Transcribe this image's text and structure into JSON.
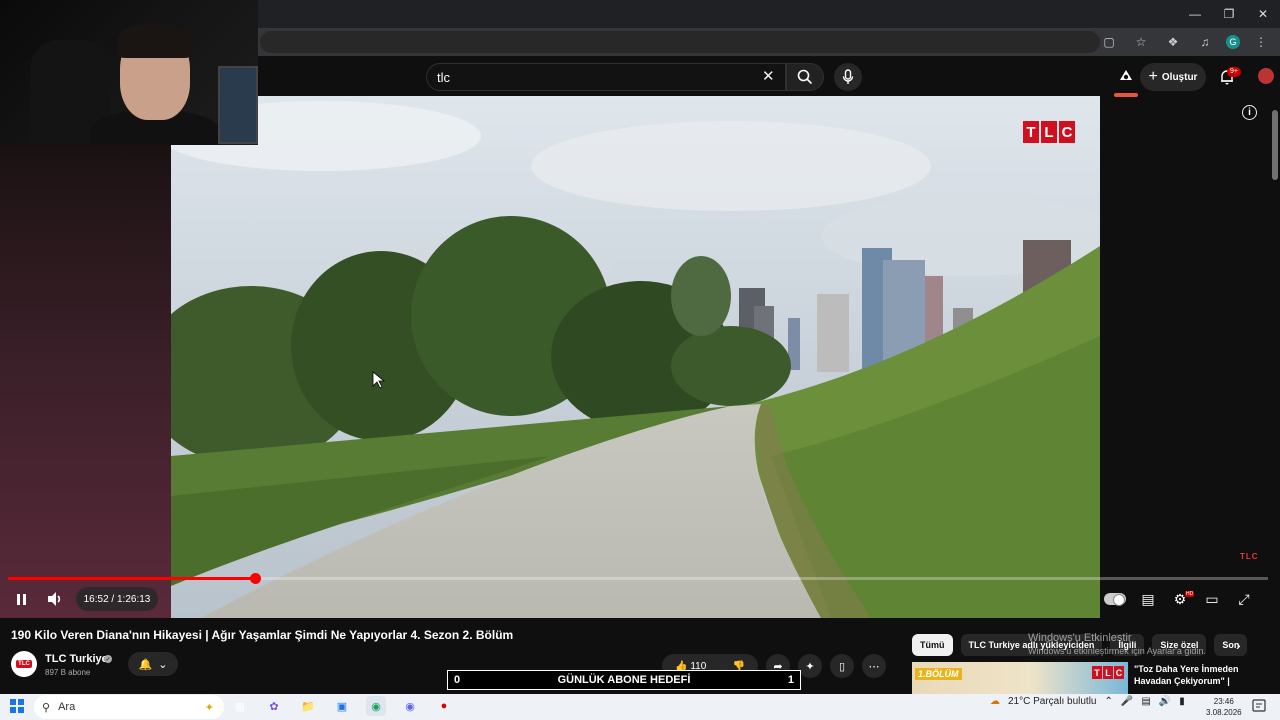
{
  "search": {
    "query": "tlc"
  },
  "header": {
    "create_label": "Oluştur",
    "notifications_badge": "9+"
  },
  "player": {
    "time": "16:52 / 1:26:13",
    "progress_fraction": 0.196,
    "logo_letters": [
      "T",
      "L",
      "C"
    ],
    "corner_brand": "TLC"
  },
  "video": {
    "title": "190 Kilo Veren Diana'nın Hikayesi | Ağır Yaşamlar Şimdi Ne Yapıyorlar 4. Sezon 2. Bölüm",
    "channel_name": "TLC Turkiye",
    "channel_avatar_text": "TLC",
    "subscribers": "897 B abone",
    "likes": "110"
  },
  "goal_overlay": {
    "left": "0",
    "label": "GÜNLÜK ABONE HEDEFİ",
    "right": "1"
  },
  "chips": [
    {
      "label": "Tümü",
      "active": true
    },
    {
      "label": "TLC Turkiye adlı yükleyiciden",
      "active": false
    },
    {
      "label": "İlgili",
      "active": false
    },
    {
      "label": "Size özel",
      "active": false
    },
    {
      "label": "Son",
      "active": false
    }
  ],
  "recommendation": {
    "tag": "1.BÖLÜM",
    "title": "\"Toz Daha Yere İnmeden Havadan Çekiyorum\" |"
  },
  "windows": {
    "activate_title": "Windows'u Etkinleştir",
    "activate_sub": "Windows'u etkinleştirmek için Ayarlar'a gidin.",
    "search_placeholder": "Ara",
    "weather": "21°C  Parçalı bulutlu",
    "time": "23:46",
    "date": "3.08.2026"
  },
  "icons": {
    "accent": "#ff0000",
    "brand": "#d0101f"
  }
}
